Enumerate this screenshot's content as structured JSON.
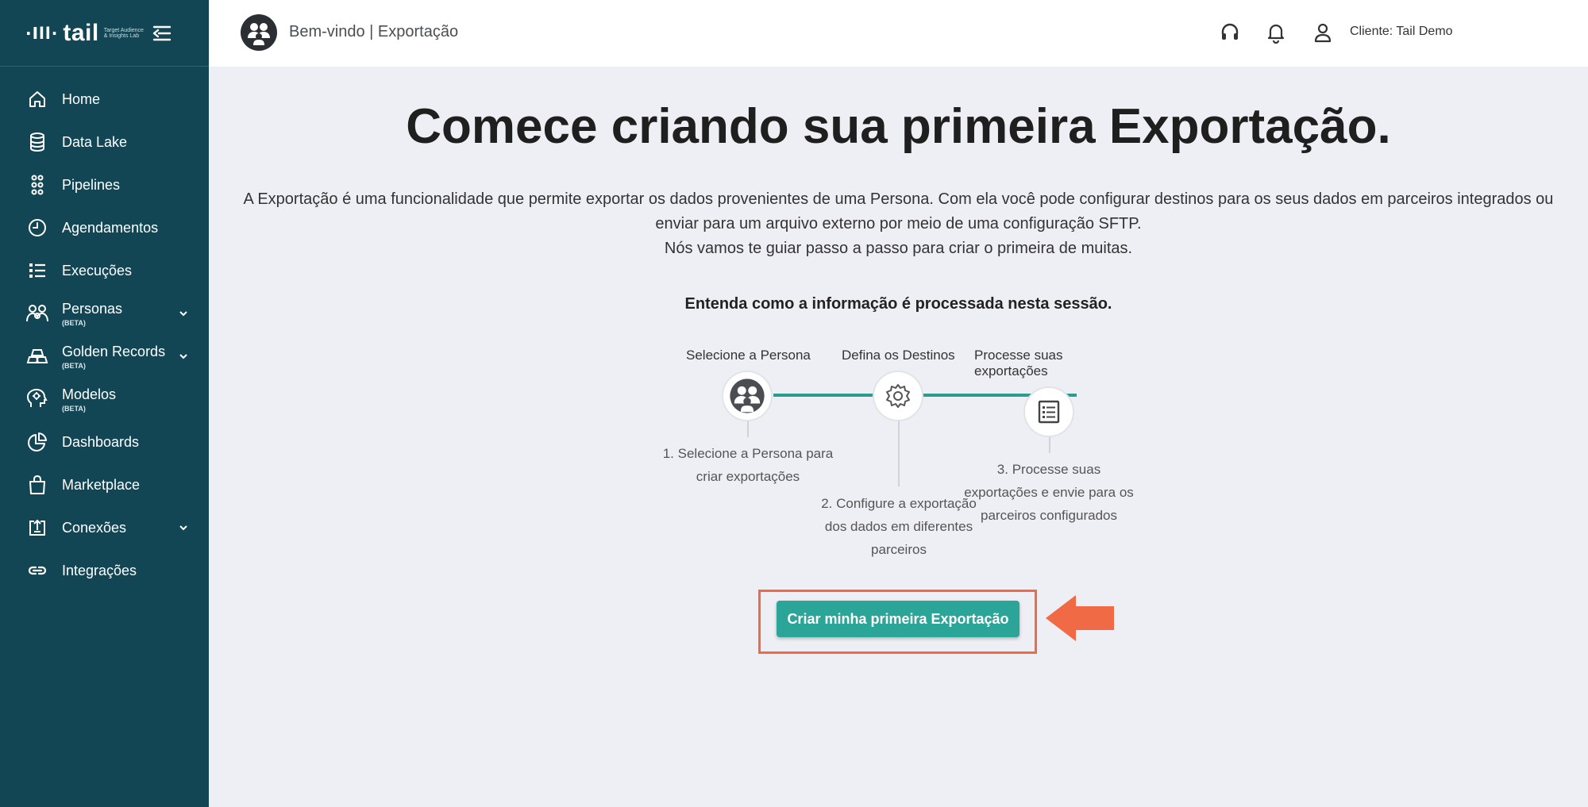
{
  "brand": {
    "mark": "·Ill·",
    "name": "tail",
    "tagline": "Target Audience & Insights Lab"
  },
  "sidebar": {
    "items": [
      {
        "label": "Home",
        "icon": "home-icon"
      },
      {
        "label": "Data Lake",
        "icon": "database-icon"
      },
      {
        "label": "Pipelines",
        "icon": "pipelines-icon"
      },
      {
        "label": "Agendamentos",
        "icon": "clock-icon"
      },
      {
        "label": "Execuções",
        "icon": "list-icon"
      },
      {
        "label": "Personas",
        "beta": "(BETA)",
        "icon": "people-icon",
        "expandable": true
      },
      {
        "label": "Golden Records",
        "beta": "(BETA)",
        "icon": "gold-bars-icon",
        "expandable": true
      },
      {
        "label": "Modelos",
        "beta": "(BETA)",
        "icon": "ai-head-icon"
      },
      {
        "label": "Dashboards",
        "icon": "pie-chart-icon"
      },
      {
        "label": "Marketplace",
        "icon": "bag-icon"
      },
      {
        "label": "Conexões",
        "icon": "upload-box-icon",
        "expandable": true
      },
      {
        "label": "Integrações",
        "icon": "link-icon"
      }
    ]
  },
  "topbar": {
    "title": "Bem-vindo | Exportação",
    "client": "Cliente: Tail Demo"
  },
  "main": {
    "headline": "Comece criando sua primeira Exportação.",
    "desc_line1": "A Exportação é uma funcionalidade que permite exportar os dados provenientes de uma Persona. Com ela você pode configurar destinos para os seus dados em parceiros integrados ou",
    "desc_line2": "enviar para um arquivo externo por meio de uma configuração SFTP.",
    "desc_line3": "Nós vamos te guiar passo a passo para criar o primeira de muitas.",
    "subhead": "Entenda como a informação é processada nesta sessão.",
    "steps": [
      {
        "title": "Selecione a Persona",
        "desc_l1": "1. Selecione a Persona para",
        "desc_l2": "criar exportações",
        "icon": "persona-icon"
      },
      {
        "title": "Defina os Destinos",
        "desc_l1": "2. Configure a exportação",
        "desc_l2": "dos dados em diferentes",
        "desc_l3": "parceiros",
        "icon": "gear-icon"
      },
      {
        "title_l1": "Processe suas",
        "title_l2": "exportações",
        "desc_l1": "3. Processe suas",
        "desc_l2": "exportações e envie para os",
        "desc_l3": "parceiros configurados",
        "icon": "document-list-icon"
      }
    ],
    "cta_label": "Criar minha primeira Exportação"
  },
  "colors": {
    "sidebar_bg": "#124655",
    "accent": "#2aa597",
    "highlight": "#f06a45",
    "page_bg": "#eeeff5"
  }
}
